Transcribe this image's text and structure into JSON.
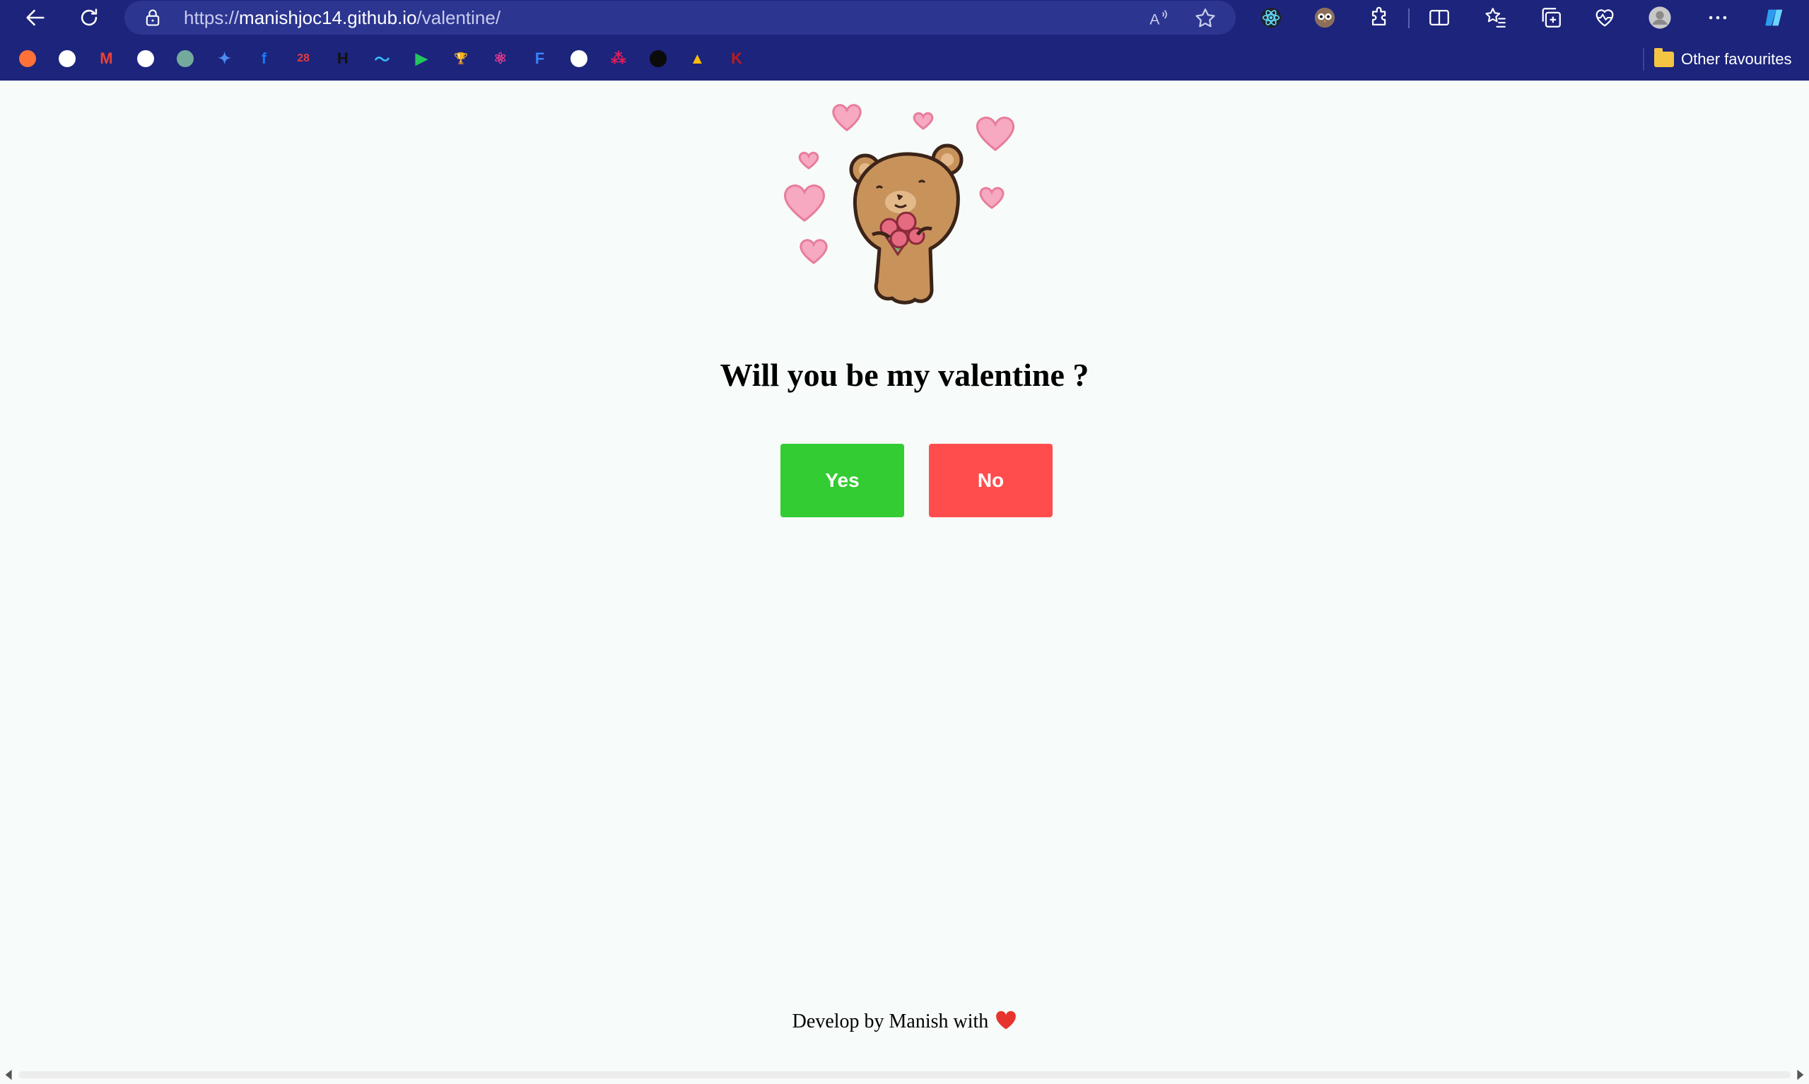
{
  "browser": {
    "url_prefix": "https://",
    "url_host": "manishjoc14.github.io",
    "url_path": "/valentine/",
    "other_favourites_label": "Other favourites",
    "bookmarks": [
      {
        "icon": "firefox-icon",
        "color": "#ff7139",
        "glyph": ""
      },
      {
        "icon": "github-icon",
        "color": "#ffffff",
        "glyph": ""
      },
      {
        "icon": "gmail-icon",
        "color": "#ea4335",
        "glyph": "M"
      },
      {
        "icon": "document-icon",
        "color": "#ffffff",
        "glyph": ""
      },
      {
        "icon": "chatgpt-icon",
        "color": "#74aa9c",
        "glyph": ""
      },
      {
        "icon": "gemini-icon",
        "color": "#4d8bf0",
        "glyph": "✦"
      },
      {
        "icon": "facebook-icon",
        "color": "#1877f2",
        "glyph": "f"
      },
      {
        "icon": "calendar-badge-icon",
        "color": "#e23b3b",
        "glyph": "28"
      },
      {
        "icon": "hashnode-icon",
        "color": "#111111",
        "glyph": "H"
      },
      {
        "icon": "tailwind-icon",
        "color": "#38bdf8",
        "glyph": "〜"
      },
      {
        "icon": "play-circle-icon",
        "color": "#22c55e",
        "glyph": "▶"
      },
      {
        "icon": "trophy-icon",
        "color": "#111111",
        "glyph": "🏆"
      },
      {
        "icon": "react-icon",
        "color": "#e23b8f",
        "glyph": "⚛"
      },
      {
        "icon": "forms-icon",
        "color": "#3b82f6",
        "glyph": "F"
      },
      {
        "icon": "github-icon",
        "color": "#ffffff",
        "glyph": ""
      },
      {
        "icon": "slack-icon",
        "color": "#e01e5a",
        "glyph": "⁂"
      },
      {
        "icon": "terminal-icon",
        "color": "#0b0b0b",
        "glyph": ""
      },
      {
        "icon": "google-drive-icon",
        "color": "#fbbc04",
        "glyph": "▲"
      },
      {
        "icon": "codechef-icon",
        "color": "#b91c1c",
        "glyph": "K"
      }
    ]
  },
  "page": {
    "question": "Will you be my valentine ?",
    "yes_label": "Yes",
    "no_label": "No",
    "footer_text": "Develop by Manish with"
  },
  "colors": {
    "browser_bar": "#1c247c",
    "page_bg": "#f7fbf9",
    "yes_button": "#33cc33",
    "no_button": "#ff4d4d",
    "heart": "#e8342f"
  }
}
